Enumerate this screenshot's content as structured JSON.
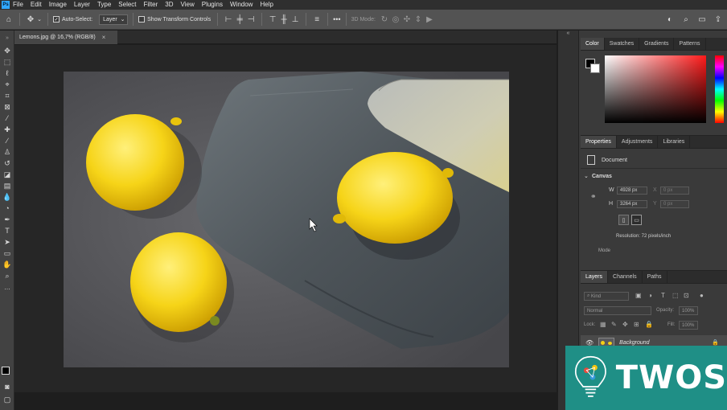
{
  "menubar": {
    "items": [
      "File",
      "Edit",
      "Image",
      "Layer",
      "Type",
      "Select",
      "Filter",
      "3D",
      "View",
      "Plugins",
      "Window",
      "Help"
    ]
  },
  "options": {
    "auto_select_label": "Auto-Select:",
    "layer_dropdown": "Layer",
    "transform_label": "Show Transform Controls",
    "more_label": "•••",
    "mode_3d": "3D Mode:"
  },
  "document": {
    "tab_title": "Lemons.jpg @ 16,7% (RGB/8)",
    "close": "×"
  },
  "panel": {
    "color_tabs": [
      "Color",
      "Swatches",
      "Gradients",
      "Patterns"
    ],
    "prop_tabs": [
      "Properties",
      "Adjustments",
      "Libraries"
    ],
    "doc_label": "Document",
    "canvas_section": "Canvas",
    "w_label": "W",
    "w_value": "4928 px",
    "h_label": "H",
    "h_value": "3264 px",
    "x_label": "X",
    "x_value": "0 px",
    "y_label": "Y",
    "y_value": "0 px",
    "resolution": "Resolution: 72 pixels/inch",
    "mode_label": "Mode",
    "layer_tabs": [
      "Layers",
      "Channels",
      "Paths"
    ],
    "kind_label": "Kind",
    "blend_mode": "Normal",
    "opacity_label": "Opacity:",
    "opacity_value": "100%",
    "lock_label": "Lock:",
    "fill_label": "Fill:",
    "fill_value": "100%",
    "layer_name": "Background",
    "collapse": "«"
  },
  "watermark": {
    "text": "TWOS"
  },
  "colors": {
    "accent": "#31a8ff",
    "watermark_bg": "#1f8f86",
    "lemon": "#f4d016"
  }
}
